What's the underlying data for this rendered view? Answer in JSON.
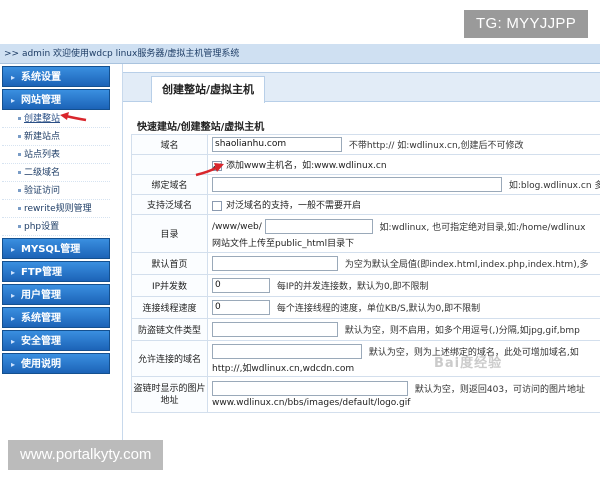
{
  "badge_top": "TG: MYYJJPP",
  "badge_bottom": "www.portalkyty.com",
  "breadcrumb": ">> admin 欢迎使用wdcp linux服务器/虚拟主机管理系统",
  "sidebar": {
    "groups": [
      {
        "label": "系统设置",
        "items": []
      },
      {
        "label": "网站管理",
        "items": [
          "创建整站",
          "新建站点",
          "站点列表",
          "二级域名",
          "验证访问",
          "rewrite规则管理",
          "php设置"
        ]
      },
      {
        "label": "MYSQL管理",
        "items": []
      },
      {
        "label": "FTP管理",
        "items": []
      },
      {
        "label": "用户管理",
        "items": []
      },
      {
        "label": "系统管理",
        "items": []
      },
      {
        "label": "安全管理",
        "items": []
      },
      {
        "label": "使用说明",
        "items": []
      }
    ]
  },
  "main": {
    "tab": "创建整站/虚拟主机",
    "section_title": "快速建站/创建整站/虚拟主机",
    "rows": {
      "domain": {
        "label": "域名",
        "value": "shaolianhu.com",
        "note": "不带http:// 如:wdlinux.cn,创建后不可修改"
      },
      "www": {
        "checked": true,
        "text": "添加www主机名，如:www.wdlinux.cn"
      },
      "bind": {
        "label": "绑定域名",
        "value": "",
        "note": "如:blog.wdlinux.cn 多"
      },
      "wildcard": {
        "label": "支持泛域名",
        "checked": false,
        "text": "对泛域名的支持，一般不需要开启"
      },
      "dir": {
        "label": "目录",
        "prefix": "/www/web/",
        "value": "",
        "note": "如:wdlinux, 也可指定绝对目录,如:/home/wdlinux",
        "note2": "网站文件上传至public_html目录下"
      },
      "index": {
        "label": "默认首页",
        "value": "",
        "note": "为空为默认全局值(即index.html,index.php,index.htm),多"
      },
      "ip": {
        "label": "IP并发数",
        "value": "0",
        "note": "每IP的并发连接数，默认为0,即不限制"
      },
      "speed": {
        "label": "连接线程速度",
        "value": "0",
        "note": "每个连接线程的速度，单位KB/S,默认为0,即不限制"
      },
      "hotlink": {
        "label": "防盗链文件类型",
        "value": "",
        "note": "默认为空，则不启用，如多个用逗号(,)分隔,如jpg,gif,bmp"
      },
      "allowed": {
        "label": "允许连接的域名",
        "value": "",
        "note": "默认为空，则为上述绑定的域名，此处可增加域名,如",
        "note2": "http://,如wdlinux.cn,wdcdn.com"
      },
      "hotlink_img": {
        "label": "盗链时显示的图片地址",
        "value": "",
        "note": "默认为空，则返回403，可访问的图片地址",
        "note2": "www.wdlinux.cn/bbs/images/default/logo.gif"
      }
    }
  },
  "watermark": "Bai度经验",
  "colors": {
    "sidebar_head": "#1c63b7",
    "breadcrumb_bg": "#cfe0f2",
    "arrow": "#d9262c"
  }
}
